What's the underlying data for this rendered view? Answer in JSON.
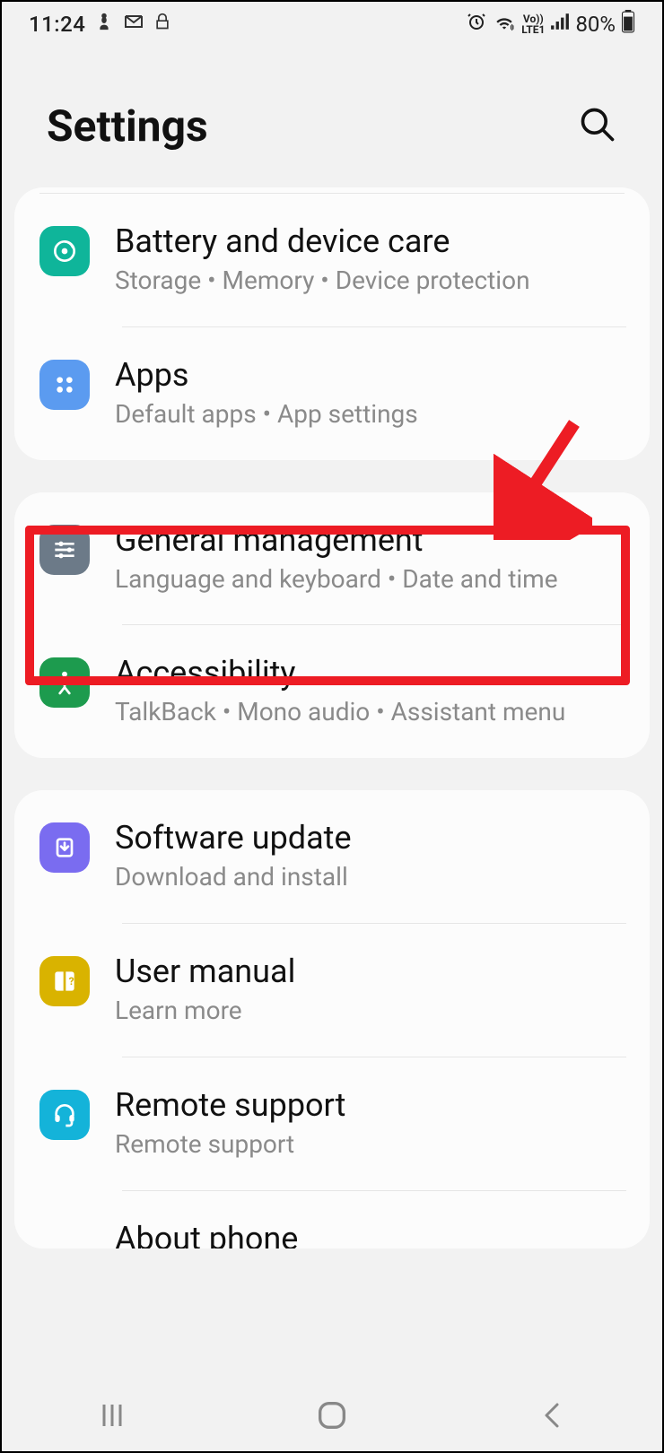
{
  "status": {
    "time": "11:24",
    "battery_pct": "80%",
    "lte_label": "Vo))\nLTE1"
  },
  "header": {
    "title": "Settings"
  },
  "groups": [
    {
      "items": [
        {
          "key": "battery",
          "title": "Battery and device care",
          "sub": "Storage  •  Memory  •  Device protection",
          "icon_bg": "#0fb59a"
        },
        {
          "key": "apps",
          "title": "Apps",
          "sub": "Default apps  •  App settings",
          "icon_bg": "#5b9bf0"
        }
      ]
    },
    {
      "items": [
        {
          "key": "general",
          "title": "General management",
          "sub": "Language and keyboard  •  Date and time",
          "icon_bg": "#6c7a88",
          "highlighted": true
        },
        {
          "key": "accessibility",
          "title": "Accessibility",
          "sub": "TalkBack  •  Mono audio  •  Assistant menu",
          "icon_bg": "#1d9b4e"
        }
      ]
    },
    {
      "items": [
        {
          "key": "software",
          "title": "Software update",
          "sub": "Download and install",
          "icon_bg": "#7a6cf0"
        },
        {
          "key": "manual",
          "title": "User manual",
          "sub": "Learn more",
          "icon_bg": "#d9b300"
        },
        {
          "key": "remote",
          "title": "Remote support",
          "sub": "Remote support",
          "icon_bg": "#14b3d9"
        },
        {
          "key": "about",
          "title": "About phone",
          "sub": "",
          "icon_bg": "#6c7a88",
          "clipped": true
        }
      ]
    }
  ],
  "annotation": {
    "arrow_color": "#ed1c24",
    "box_color": "#ed1c24"
  }
}
